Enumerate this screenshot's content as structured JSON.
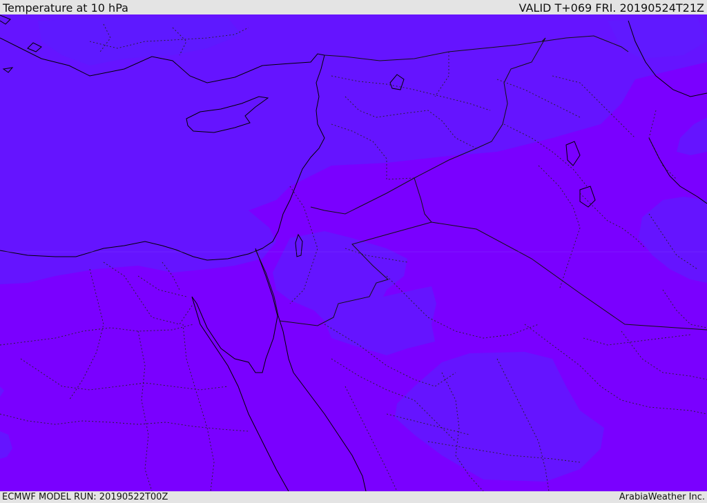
{
  "header": {
    "title": "Temperature at 10 hPa",
    "valid": "VALID T+069 FRI. 20190524T21Z"
  },
  "footer": {
    "model_run": "ECMWF MODEL RUN: 20190522T00Z",
    "credit": "ArabiaWeather Inc."
  },
  "map": {
    "colors": {
      "warm_band": "#7a00ff",
      "cool_band": "#6514ff",
      "coastline": "#000000",
      "border": "#111111"
    }
  }
}
